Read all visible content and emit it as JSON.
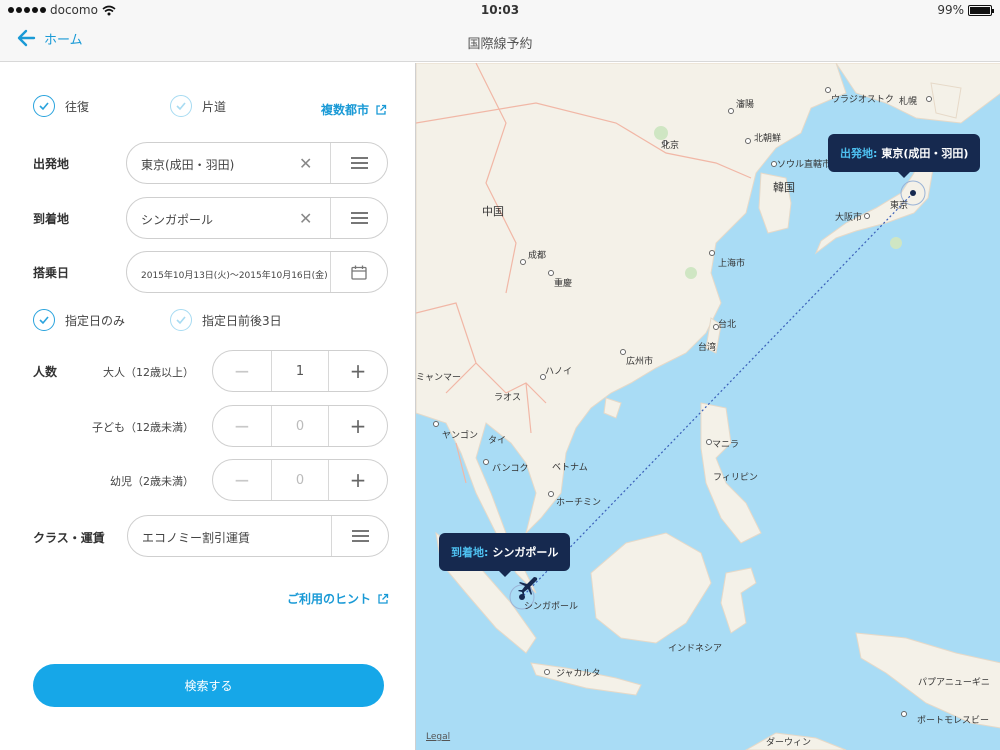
{
  "status_bar": {
    "carrier": "docomo",
    "time": "10:03",
    "battery": "99%"
  },
  "nav": {
    "back_label": "ホーム",
    "title": "国際線予約"
  },
  "trip_type": {
    "round_trip": "往復",
    "one_way": "片道",
    "multi_city": "複数都市"
  },
  "departure": {
    "label": "出発地",
    "value": "東京(成田・羽田)"
  },
  "arrival": {
    "label": "到着地",
    "value": "シンガポール"
  },
  "date": {
    "label": "搭乗日",
    "value": "2015年10月13日(火)〜2015年10月16日(金)"
  },
  "date_options": {
    "exact": "指定日のみ",
    "flex": "指定日前後3日"
  },
  "passengers": {
    "label": "人数",
    "adult_label": "大人（12歳以上）",
    "adult_count": "1",
    "child_label": "子ども（12歳未満）",
    "child_count": "0",
    "infant_label": "幼児（2歳未満）",
    "infant_count": "0"
  },
  "fare_class": {
    "label": "クラス・運賃",
    "value": "エコノミー割引運賃"
  },
  "hint_link": "ご利用のヒント",
  "search_button": "検索する",
  "map": {
    "origin_key": "出発地:",
    "origin_value": "東京(成田・羽田)",
    "dest_key": "到着地:",
    "dest_value": "シンガポール",
    "legal": "Legal",
    "countries": {
      "china": "中国",
      "korea": "韓国",
      "myanmar": "ミャンマー",
      "laos": "ラオス",
      "thailand": "タイ",
      "vietnam": "ベトナム",
      "philippines": "フィリピン",
      "indonesia": "インドネシア",
      "png": "パプアニューギニ",
      "taiwan": "台湾"
    },
    "cities": {
      "vladivostok": "ウラジオストク",
      "sapporo": "札幌",
      "shenyang": "瀋陽",
      "pyongyang": "北朝鮮",
      "beijing": "北京",
      "seoul": "ソウル直轄市",
      "tokyo": "東京",
      "osaka": "大阪市",
      "chengdu": "成都",
      "chongqing": "重慶",
      "shanghai": "上海市",
      "taipei": "台北",
      "guangzhou": "広州市",
      "hanoi": "ハノイ",
      "yangon": "ヤンゴン",
      "bangkok": "バンコク",
      "hcmc": "ホーチミン",
      "manila": "マニラ",
      "singapore": "シンガポール",
      "jakarta": "ジャカルタ",
      "moresby": "ポートモレスビー",
      "darwin": "ダーウィン"
    }
  },
  "colors": {
    "accent": "#16a7e8",
    "bubble": "#16294f",
    "sea": "#a9dcf5",
    "land": "#f5f2ea"
  }
}
